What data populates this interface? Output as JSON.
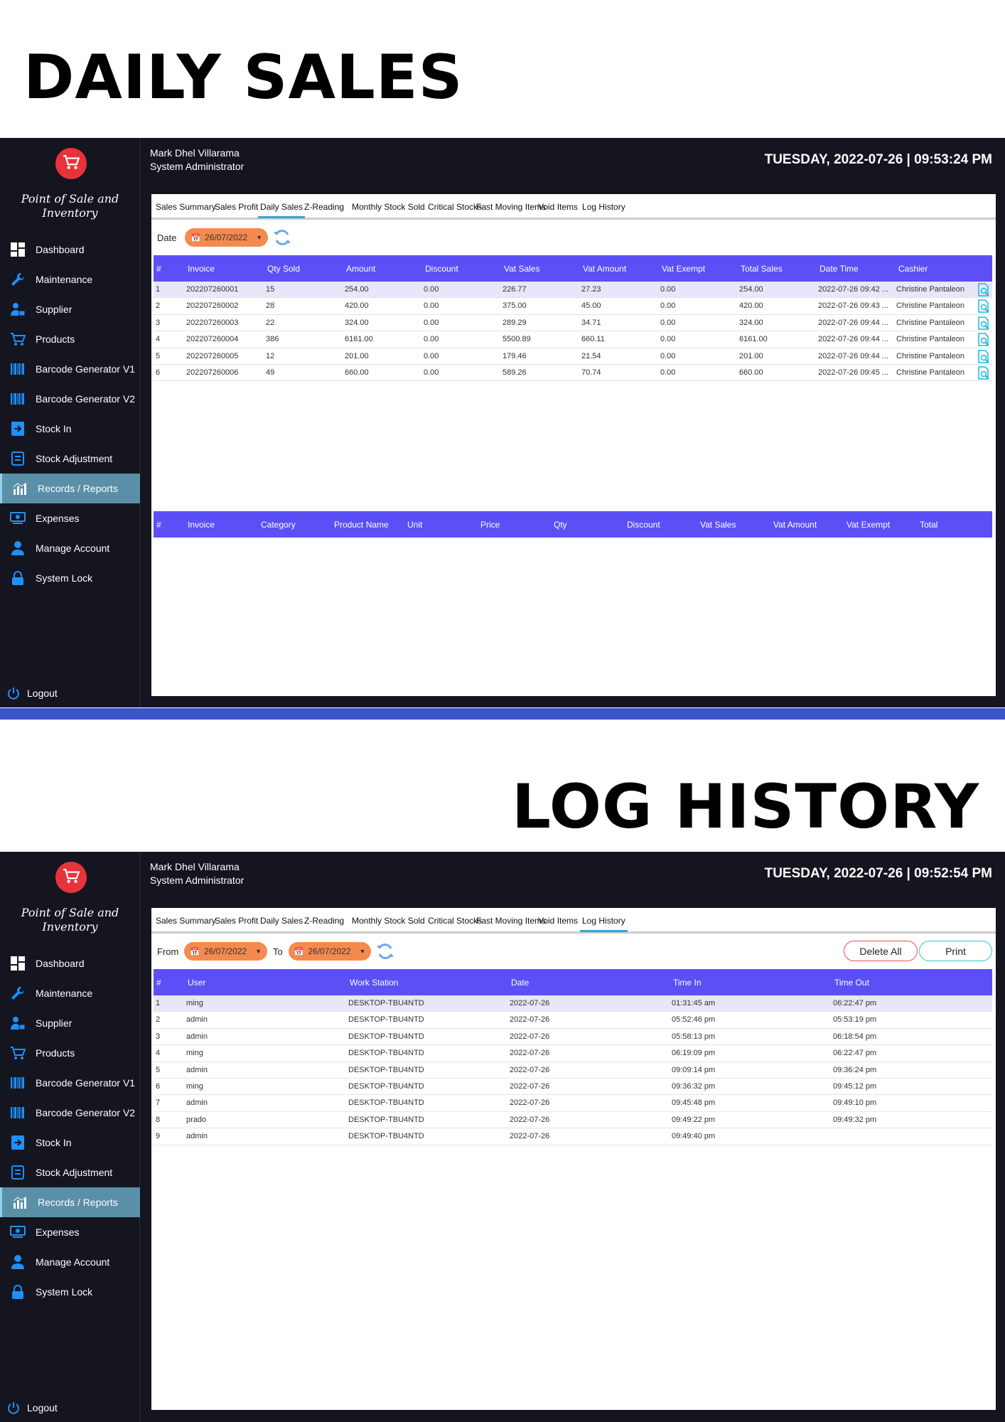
{
  "headings": {
    "daily_sales": "DAILY SALES",
    "log_history": "LOG HISTORY"
  },
  "app": {
    "title_line1": "Point of Sale and",
    "title_line2": "Inventory"
  },
  "user": {
    "name": "Mark Dhel Villarama",
    "role": "System Administrator"
  },
  "nav": [
    {
      "label": "Dashboard",
      "icon": "dashboard-icon"
    },
    {
      "label": "Maintenance",
      "icon": "wrench-icon"
    },
    {
      "label": "Supplier",
      "icon": "supplier-icon"
    },
    {
      "label": "Products",
      "icon": "cart-icon"
    },
    {
      "label": "Barcode Generator V1",
      "icon": "barcode-icon"
    },
    {
      "label": "Barcode Generator V2",
      "icon": "barcode-icon"
    },
    {
      "label": "Stock In",
      "icon": "stock-in-icon"
    },
    {
      "label": "Stock Adjustment",
      "icon": "adjustment-icon"
    },
    {
      "label": "Records / Reports",
      "icon": "chart-icon",
      "active": true
    },
    {
      "label": "Expenses",
      "icon": "expenses-icon"
    },
    {
      "label": "Manage Account",
      "icon": "user-icon"
    },
    {
      "label": "System Lock",
      "icon": "lock-icon"
    }
  ],
  "logout": "Logout",
  "tabs": [
    "Sales Summary",
    "Sales Profit",
    "Daily Sales",
    "Z-Reading",
    "Monthly Stock Sold",
    "Critical Stocks",
    "Fast Moving Items",
    "Void Items",
    "Log History"
  ],
  "daily": {
    "clock": "TUESDAY, 2022-07-26 | 09:53:24 PM",
    "date_label": "Date",
    "date_value": "26/07/2022",
    "columns": [
      "#",
      "Invoice",
      "Qty Sold",
      "Amount",
      "Discount",
      "Vat Sales",
      "Vat Amount",
      "Vat Exempt",
      "Total Sales",
      "Date Time",
      "Cashier"
    ],
    "rows": [
      [
        "1",
        "202207260001",
        "15",
        "254.00",
        "0.00",
        "226.77",
        "27.23",
        "0.00",
        "254.00",
        "2022-07-26 09:42 ...",
        "Christine Pantaleon"
      ],
      [
        "2",
        "202207260002",
        "28",
        "420.00",
        "0.00",
        "375.00",
        "45.00",
        "0.00",
        "420.00",
        "2022-07-26 09:43 ...",
        "Christine Pantaleon"
      ],
      [
        "3",
        "202207260003",
        "22",
        "324.00",
        "0.00",
        "289.29",
        "34.71",
        "0.00",
        "324.00",
        "2022-07-26 09:44 ...",
        "Christine Pantaleon"
      ],
      [
        "4",
        "202207260004",
        "386",
        "6161.00",
        "0.00",
        "5500.89",
        "660.11",
        "0.00",
        "6161.00",
        "2022-07-26 09:44 ...",
        "Christine Pantaleon"
      ],
      [
        "5",
        "202207260005",
        "12",
        "201.00",
        "0.00",
        "179.46",
        "21.54",
        "0.00",
        "201.00",
        "2022-07-26 09:44 ...",
        "Christine Pantaleon"
      ],
      [
        "6",
        "202207260006",
        "49",
        "660.00",
        "0.00",
        "589.26",
        "70.74",
        "0.00",
        "660.00",
        "2022-07-26 09:45 ...",
        "Christine Pantaleon"
      ]
    ],
    "detail_columns": [
      "#",
      "Invoice",
      "Category",
      "Product Name",
      "Unit",
      "Price",
      "Qty",
      "Discount",
      "Vat Sales",
      "Vat Amount",
      "Vat Exempt",
      "Total"
    ]
  },
  "log": {
    "clock": "TUESDAY, 2022-07-26 | 09:52:54 PM",
    "from_label": "From",
    "from_value": "26/07/2022",
    "to_label": "To",
    "to_value": "26/07/2022",
    "delete_all": "Delete All",
    "print": "Print",
    "columns": [
      "#",
      "User",
      "Work Station",
      "Date",
      "Time In",
      "Time Out"
    ],
    "rows": [
      [
        "1",
        "ming",
        "DESKTOP-TBU4NTD",
        "2022-07-26",
        "01:31:45 am",
        "06:22:47 pm"
      ],
      [
        "2",
        "admin",
        "DESKTOP-TBU4NTD",
        "2022-07-26",
        "05:52:46 pm",
        "05:53:19 pm"
      ],
      [
        "3",
        "admin",
        "DESKTOP-TBU4NTD",
        "2022-07-26",
        "05:58:13 pm",
        "06:18:54 pm"
      ],
      [
        "4",
        "ming",
        "DESKTOP-TBU4NTD",
        "2022-07-26",
        "06:19:09 pm",
        "06:22:47 pm"
      ],
      [
        "5",
        "admin",
        "DESKTOP-TBU4NTD",
        "2022-07-26",
        "09:09:14 pm",
        "09:36:24 pm"
      ],
      [
        "6",
        "ming",
        "DESKTOP-TBU4NTD",
        "2022-07-26",
        "09:36:32 pm",
        "09:45:12 pm"
      ],
      [
        "7",
        "admin",
        "DESKTOP-TBU4NTD",
        "2022-07-26",
        "09:45:48 pm",
        "09:49:10 pm"
      ],
      [
        "8",
        "prado",
        "DESKTOP-TBU4NTD",
        "2022-07-26",
        "09:49:22 pm",
        "09:49:32 pm"
      ],
      [
        "9",
        "admin",
        "DESKTOP-TBU4NTD",
        "2022-07-26",
        "09:49:40 pm",
        ""
      ]
    ]
  },
  "colors": {
    "header_bg": "#5c4ff6",
    "date_picker": "#f48a4e",
    "active_nav": "#5a8fa8",
    "logo": "#e8333b",
    "icon_blue": "#1e90ff",
    "band": "#3a55c8"
  }
}
